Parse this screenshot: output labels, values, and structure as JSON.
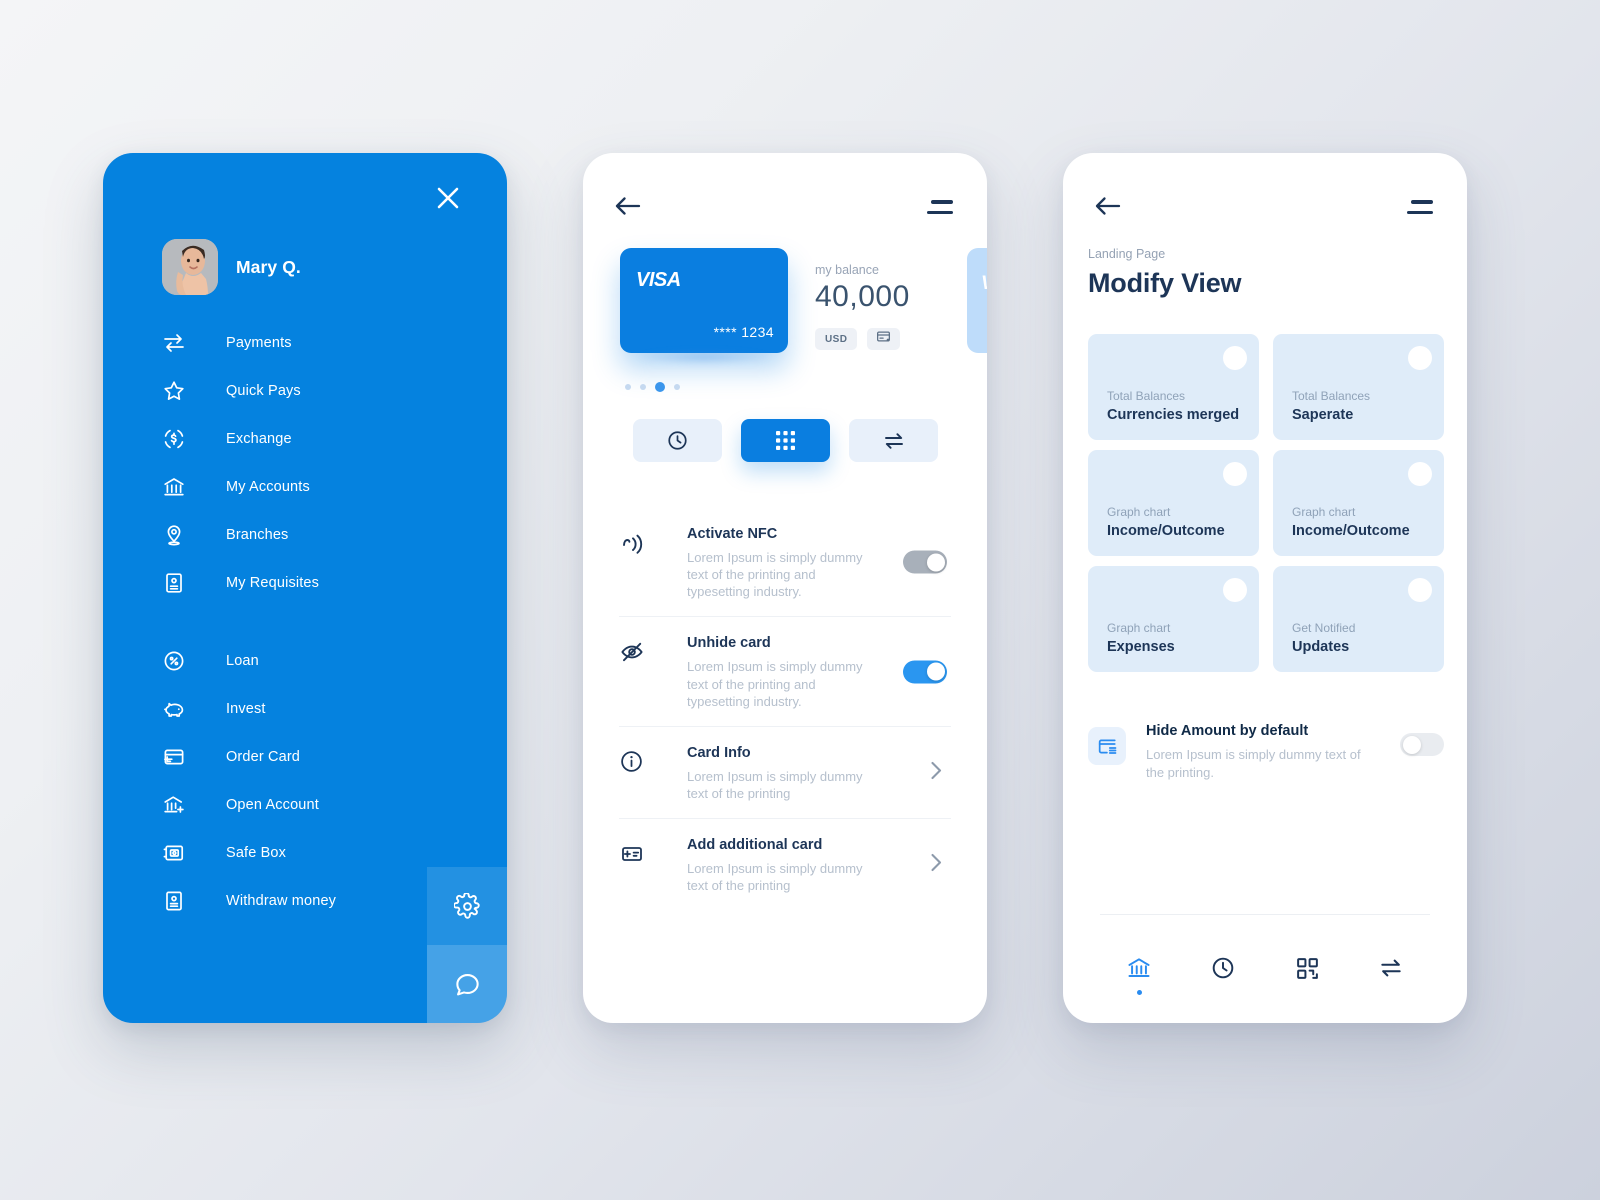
{
  "theme": {
    "brand_blue": "#0582df",
    "card_blue": "#0a7ee0",
    "navy": "#1d3557",
    "muted": "#b6c0cd",
    "card_tint": "#dfecf9",
    "bg_from": "#f4f5f7",
    "bg_to": "#ccd1dd"
  },
  "sidebar": {
    "close_icon": "close-icon",
    "profile": {
      "name": "Mary Q.",
      "avatar_alt": "user-avatar"
    },
    "items": [
      {
        "label": "Payments",
        "icon": "transfer-arrows-icon"
      },
      {
        "label": "Quick Pays",
        "icon": "star-icon"
      },
      {
        "label": "Exchange",
        "icon": "currency-exchange-icon"
      },
      {
        "label": "My Accounts",
        "icon": "bank-icon"
      },
      {
        "label": "Branches",
        "icon": "map-pin-icon"
      },
      {
        "label": "My Requisites",
        "icon": "id-card-icon"
      }
    ],
    "items_secondary": [
      {
        "label": "Loan",
        "icon": "percent-circle-icon"
      },
      {
        "label": "Invest",
        "icon": "piggy-bank-icon"
      },
      {
        "label": "Order Card",
        "icon": "card-add-icon"
      },
      {
        "label": "Open Account",
        "icon": "bank-add-icon"
      },
      {
        "label": "Safe Box",
        "icon": "safe-box-icon"
      },
      {
        "label": "Withdraw money",
        "icon": "withdraw-document-icon"
      }
    ],
    "corner_buttons": [
      {
        "name": "settings",
        "icon": "gear-icon"
      },
      {
        "name": "chat",
        "icon": "chat-bubble-icon"
      }
    ]
  },
  "card_screen": {
    "back_icon": "back-arrow-icon",
    "menu_icon": "hamburger-menu-icon",
    "card": {
      "brand": "VISA",
      "masked_number": "**** 1234"
    },
    "next_card_brand": "V",
    "balance": {
      "label": "my balance",
      "value": "40,000",
      "currency": "USD",
      "card_action_icon": "card-add-icon"
    },
    "carousel": {
      "total": 4,
      "active_index": 2
    },
    "segments": [
      {
        "icon": "clock-icon",
        "active": false
      },
      {
        "icon": "grid-icon",
        "active": true
      },
      {
        "icon": "transfer-icon",
        "active": false
      }
    ],
    "settings": [
      {
        "icon": "nfc-icon",
        "title": "Activate NFC",
        "desc": "Lorem Ipsum is simply dummy text of the printing and typesetting industry.",
        "control": "toggle",
        "state": "off"
      },
      {
        "icon": "eye-off-icon",
        "title": "Unhide card",
        "desc": "Lorem Ipsum is simply dummy text of the printing and typesetting industry.",
        "control": "toggle",
        "state": "on"
      },
      {
        "icon": "info-circle-icon",
        "title": "Card Info",
        "desc": "Lorem Ipsum is simply dummy text of the printing",
        "control": "chevron",
        "state": ""
      },
      {
        "icon": "card-add-icon",
        "title": "Add additional card",
        "desc": "Lorem Ipsum is simply dummy text of the printing",
        "control": "chevron",
        "state": ""
      }
    ]
  },
  "modify_screen": {
    "back_icon": "back-arrow-icon",
    "menu_icon": "hamburger-menu-icon",
    "breadcrumb": "Landing Page",
    "title": "Modify View",
    "options": [
      {
        "sub": "Total Balances",
        "main": "Currencies merged"
      },
      {
        "sub": "Total Balances",
        "main": "Saperate"
      },
      {
        "sub": "Graph chart",
        "main": "Income/Outcome"
      },
      {
        "sub": "Graph chart",
        "main": "Income/Outcome"
      },
      {
        "sub": "Graph chart",
        "main": "Expenses"
      },
      {
        "sub": "Get Notified",
        "main": "Updates"
      }
    ],
    "hide_amount": {
      "icon": "hide-amount-card-icon",
      "title": "Hide Amount by default",
      "desc": "Lorem Ipsum is simply dummy text of the printing.",
      "state": "off"
    },
    "tabs": [
      {
        "icon": "bank-icon",
        "active": true
      },
      {
        "icon": "clock-icon",
        "active": false
      },
      {
        "icon": "qr-code-icon",
        "active": false
      },
      {
        "icon": "transfer-icon",
        "active": false
      }
    ]
  }
}
